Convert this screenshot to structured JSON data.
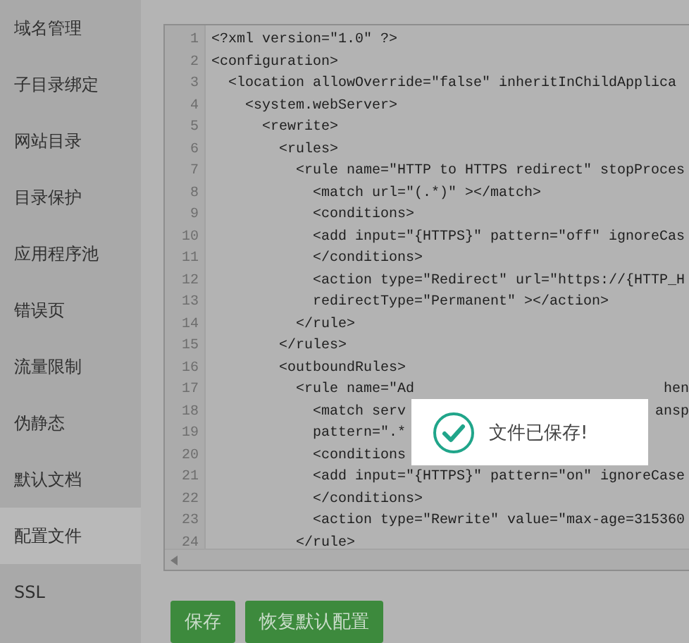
{
  "sidebar": {
    "items": [
      {
        "label": "域名管理",
        "selected": false
      },
      {
        "label": "子目录绑定",
        "selected": false
      },
      {
        "label": "网站目录",
        "selected": false
      },
      {
        "label": "目录保护",
        "selected": false
      },
      {
        "label": "应用程序池",
        "selected": false
      },
      {
        "label": "错误页",
        "selected": false
      },
      {
        "label": "流量限制",
        "selected": false
      },
      {
        "label": "伪静态",
        "selected": false
      },
      {
        "label": "默认文档",
        "selected": false
      },
      {
        "label": "配置文件",
        "selected": true
      },
      {
        "label": "SSL",
        "selected": false
      }
    ]
  },
  "editor": {
    "lines": [
      {
        "number": "1",
        "text": "<?xml version=\"1.0\" ?>"
      },
      {
        "number": "2",
        "text": "<configuration>"
      },
      {
        "number": "3",
        "text": "  <location allowOverride=\"false\" inheritInChildApplica"
      },
      {
        "number": "4",
        "text": "    <system.webServer>"
      },
      {
        "number": "5",
        "text": "      <rewrite>"
      },
      {
        "number": "6",
        "text": "        <rules>"
      },
      {
        "number": "7",
        "text": "          <rule name=\"HTTP to HTTPS redirect\" stopProces"
      },
      {
        "number": "8",
        "text": "            <match url=\"(.*)\" ></match>"
      },
      {
        "number": "9",
        "text": "            <conditions>"
      },
      {
        "number": "10",
        "text": "            <add input=\"{HTTPS}\" pattern=\"off\" ignoreCas"
      },
      {
        "number": "11",
        "text": "            </conditions>"
      },
      {
        "number": "12",
        "text": "            <action type=\"Redirect\" url=\"https://{HTTP_H"
      },
      {
        "number": "13",
        "text": "            redirectType=\"Permanent\" ></action>"
      },
      {
        "number": "14",
        "text": "          </rule>"
      },
      {
        "number": "15",
        "text": "        </rules>"
      },
      {
        "number": "16",
        "text": "        <outboundRules>"
      },
      {
        "number": "17",
        "text": "          <rule name=\"Ad",
        "tail": "hen"
      },
      {
        "number": "18",
        "text": "            <match serv",
        "tail": "ansp"
      },
      {
        "number": "19",
        "text": "            pattern=\".*"
      },
      {
        "number": "20",
        "text": "            <conditions"
      },
      {
        "number": "21",
        "text": "            <add input=\"{HTTPS}\" pattern=\"on\" ignoreCase"
      },
      {
        "number": "22",
        "text": "            </conditions>"
      },
      {
        "number": "23",
        "text": "            <action type=\"Rewrite\" value=\"max-age=315360"
      },
      {
        "number": "24",
        "text": "          </rule>"
      }
    ]
  },
  "buttons": [
    {
      "label": "保存"
    },
    {
      "label": "恢复默认配置"
    }
  ],
  "toast": {
    "message": "文件已保存!"
  }
}
